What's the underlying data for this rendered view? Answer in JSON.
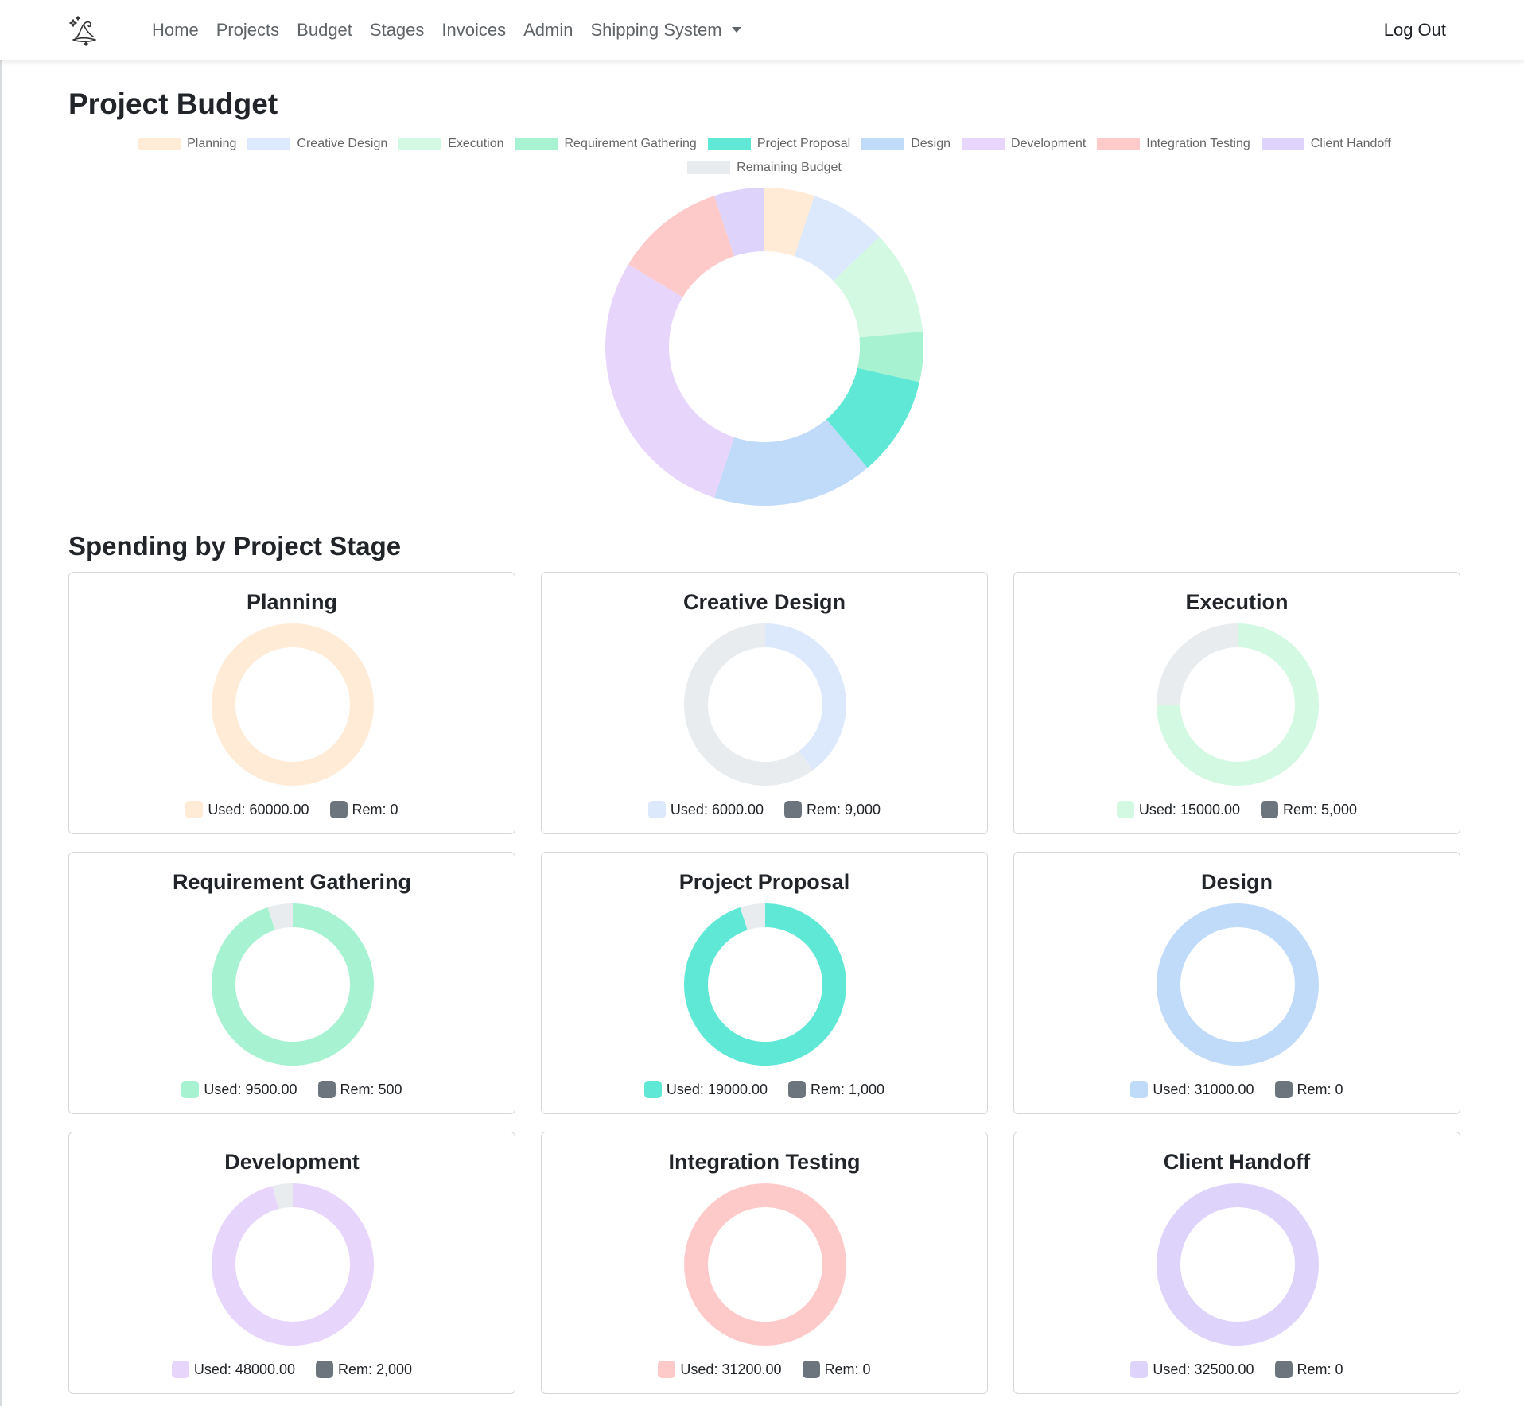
{
  "nav": {
    "brand_icon": "wizard-hat-logo-icon",
    "links": [
      "Home",
      "Projects",
      "Budget",
      "Stages",
      "Invoices",
      "Admin"
    ],
    "dropdown_label": "Shipping System",
    "logout": "Log Out"
  },
  "page": {
    "title": "Project Budget",
    "section_title": "Spending by Project Stage"
  },
  "colors": {
    "remaining": "#e9ecef",
    "rem_dot": "#6c757d"
  },
  "chart_data": [
    {
      "type": "donut",
      "title": "",
      "legend_position": "top",
      "categories": [
        "Planning",
        "Creative Design",
        "Execution",
        "Requirement Gathering",
        "Project Proposal",
        "Design",
        "Development",
        "Integration Testing",
        "Client Handoff",
        "Remaining Budget"
      ],
      "colors": [
        "#ffebd6",
        "#dce8fc",
        "#d3f9e3",
        "#a6f2d1",
        "#5ee8d5",
        "#c0daf9",
        "#e8d5fc",
        "#fec9c9",
        "#ded3fb",
        "#e9ecef"
      ],
      "values": [
        12500,
        19000,
        26000,
        12500,
        25000,
        40000,
        70000,
        27500,
        12500,
        0
      ]
    },
    {
      "type": "donut",
      "title": "Planning",
      "categories": [
        "Used",
        "Rem"
      ],
      "values": [
        60000,
        0
      ],
      "used_label": "Used: 60000.00",
      "rem_label": "Rem: 0",
      "color": "#ffebd6"
    },
    {
      "type": "donut",
      "title": "Creative Design",
      "categories": [
        "Used",
        "Rem"
      ],
      "values": [
        6000,
        9000
      ],
      "used_label": "Used: 6000.00",
      "rem_label": "Rem: 9,000",
      "color": "#dce8fc"
    },
    {
      "type": "donut",
      "title": "Execution",
      "categories": [
        "Used",
        "Rem"
      ],
      "values": [
        15000,
        5000
      ],
      "used_label": "Used: 15000.00",
      "rem_label": "Rem: 5,000",
      "color": "#d3f9e3"
    },
    {
      "type": "donut",
      "title": "Requirement Gathering",
      "categories": [
        "Used",
        "Rem"
      ],
      "values": [
        9500,
        500
      ],
      "used_label": "Used: 9500.00",
      "rem_label": "Rem: 500",
      "color": "#a6f2d1"
    },
    {
      "type": "donut",
      "title": "Project Proposal",
      "categories": [
        "Used",
        "Rem"
      ],
      "values": [
        19000,
        1000
      ],
      "used_label": "Used: 19000.00",
      "rem_label": "Rem: 1,000",
      "color": "#5ee8d5"
    },
    {
      "type": "donut",
      "title": "Design",
      "categories": [
        "Used",
        "Rem"
      ],
      "values": [
        31000,
        0
      ],
      "used_label": "Used: 31000.00",
      "rem_label": "Rem: 0",
      "color": "#c0daf9"
    },
    {
      "type": "donut",
      "title": "Development",
      "categories": [
        "Used",
        "Rem"
      ],
      "values": [
        48000,
        2000
      ],
      "used_label": "Used: 48000.00",
      "rem_label": "Rem: 2,000",
      "color": "#e8d5fc"
    },
    {
      "type": "donut",
      "title": "Integration Testing",
      "categories": [
        "Used",
        "Rem"
      ],
      "values": [
        31200,
        0
      ],
      "used_label": "Used: 31200.00",
      "rem_label": "Rem: 0",
      "color": "#fec9c9"
    },
    {
      "type": "donut",
      "title": "Client Handoff",
      "categories": [
        "Used",
        "Rem"
      ],
      "values": [
        32500,
        0
      ],
      "used_label": "Used: 32500.00",
      "rem_label": "Rem: 0",
      "color": "#ded3fb"
    }
  ]
}
